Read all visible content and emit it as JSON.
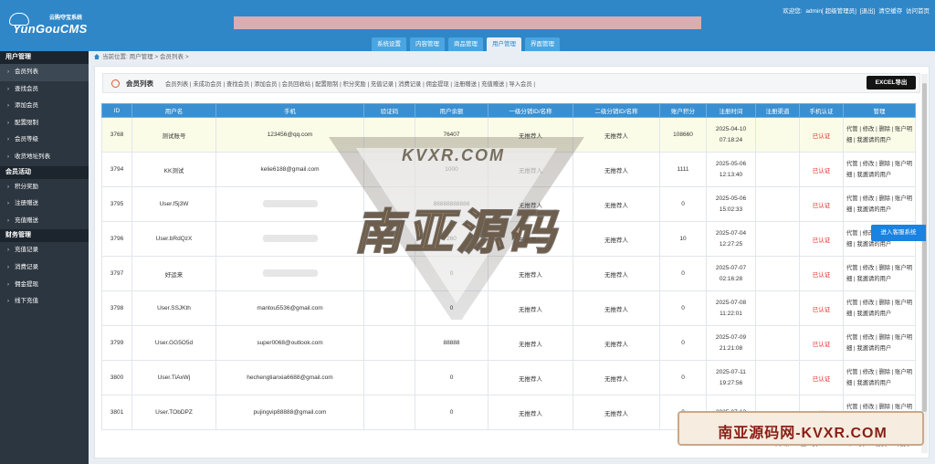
{
  "header": {
    "slogan": "云购夺宝系统",
    "brand": "YunGouCMS",
    "welcome": "欢迎您:",
    "user": "admin[ 超级管理员]",
    "logout": "[退出]",
    "clear_cache": "清空缓存",
    "visit_home": "访问首页",
    "tabs": [
      {
        "label": "系统设置",
        "active": false
      },
      {
        "label": "内容管理",
        "active": false
      },
      {
        "label": "商品管理",
        "active": false
      },
      {
        "label": "用户管理",
        "active": true
      },
      {
        "label": "界面管理",
        "active": false
      }
    ]
  },
  "sidebar": {
    "groups": [
      {
        "title": "用户管理",
        "items": [
          "会员列表",
          "查找会员",
          "添加会员",
          "配置限制",
          "会员等级",
          "收货地址列表"
        ]
      },
      {
        "title": "会员活动",
        "items": [
          "积分奖励",
          "注册赠送",
          "充值赠送"
        ]
      },
      {
        "title": "财务管理",
        "items": [
          "充值记录",
          "消费记录",
          "佣金提现",
          "线下充值"
        ]
      }
    ],
    "active_item": "会员列表"
  },
  "breadcrumb": "当前位置: 用户管理 > 会员列表 >",
  "subnav": {
    "title": "会员列表",
    "links": "会员列表 | 未成功会员 | 查找会员 | 添加会员 | 会员回收站 | 配置限制 | 积分奖励 | 充值记录 | 消费记录 | 佣金提现 | 注册赠送 | 充值赠送 | 导入会员 |",
    "excel_button": "EXCEL导出"
  },
  "table": {
    "columns": [
      "ID",
      "用户名",
      "手机",
      "验证码",
      "用户余额",
      "一级分销ID/名称",
      "二级分销ID/名称",
      "账户积分",
      "注册时间",
      "注册渠道",
      "手机认证",
      "管理"
    ],
    "rows": [
      {
        "id": "3768",
        "username": "测试账号",
        "phone": "123456@qq.com",
        "code": "",
        "balance": "76407",
        "level1": "无推荐人",
        "level2": "无推荐人",
        "points": "108660",
        "date": "2025-04-10",
        "time": "07:18:24",
        "channel": "",
        "auth": "已认证",
        "ops": "代管 | 修改 | 删除 | 账户明细 | 我邀请的用户",
        "highlight": true
      },
      {
        "id": "3794",
        "username": "KK测试",
        "phone": "kelie6188@gmail.com",
        "code": "",
        "balance": "1000",
        "level1": "无推荐人",
        "level2": "无推荐人",
        "points": "1111",
        "date": "2025-05-06",
        "time": "12:13:40",
        "channel": "",
        "auth": "已认证",
        "ops": "代管 | 修改 | 删除 | 账户明细 | 我邀请的用户",
        "highlight": false
      },
      {
        "id": "3795",
        "username": "User.f5j3W",
        "phone": "",
        "code": "",
        "balance": "88888888888",
        "level1": "无推荐人",
        "level2": "无推荐人",
        "points": "0",
        "date": "2025-05-06",
        "time": "15:02:33",
        "channel": "",
        "auth": "已认证",
        "ops": "代管 | 修改 | 删除 | 账户明细 | 我邀请的用户",
        "highlight": false
      },
      {
        "id": "3796",
        "username": "User.bRdQzX",
        "phone": "",
        "code": "",
        "balance": "260",
        "level1": "无推荐人",
        "level2": "无推荐人",
        "points": "10",
        "date": "2025-07-04",
        "time": "12:27:25",
        "channel": "",
        "auth": "已认证",
        "ops": "代管 | 修改 | 删除 | 账户明细 | 我邀请的用户",
        "highlight": false
      },
      {
        "id": "3797",
        "username": "好运来",
        "phone": "",
        "code": "",
        "balance": "0",
        "level1": "无推荐人",
        "level2": "无推荐人",
        "points": "0",
        "date": "2025-07-07",
        "time": "02:16:28",
        "channel": "",
        "auth": "已认证",
        "ops": "代管 | 修改 | 删除 | 账户明细 | 我邀请的用户",
        "highlight": false
      },
      {
        "id": "3798",
        "username": "User.SSJKth",
        "phone": "mantou5536@gmail.com",
        "code": "",
        "balance": "0",
        "level1": "无推荐人",
        "level2": "无推荐人",
        "points": "0",
        "date": "2025-07-08",
        "time": "11:22:01",
        "channel": "",
        "auth": "已认证",
        "ops": "代管 | 修改 | 删除 | 账户明细 | 我邀请的用户",
        "highlight": false
      },
      {
        "id": "3799",
        "username": "User.GG5O5d",
        "phone": "super0068@outlook.com",
        "code": "",
        "balance": "88888",
        "level1": "无推荐人",
        "level2": "无推荐人",
        "points": "0",
        "date": "2025-07-09",
        "time": "21:21:08",
        "channel": "",
        "auth": "已认证",
        "ops": "代管 | 修改 | 删除 | 账户明细 | 我邀请的用户",
        "highlight": false
      },
      {
        "id": "3800",
        "username": "User.TiAxWj",
        "phone": "hechengtianxia6688@gmail.com",
        "code": "",
        "balance": "0",
        "level1": "无推荐人",
        "level2": "无推荐人",
        "points": "0",
        "date": "2025-07-11",
        "time": "19:27:56",
        "channel": "",
        "auth": "已认证",
        "ops": "代管 | 修改 | 删除 | 账户明细 | 我邀请的用户",
        "highlight": false
      },
      {
        "id": "3801",
        "username": "User.TObDPZ",
        "phone": "pujingvip88888@gmail.com",
        "code": "",
        "balance": "0",
        "level1": "无推荐人",
        "level2": "无推荐人",
        "points": "0",
        "date": "2025-07-12",
        "time": "",
        "channel": "",
        "auth": "已认证",
        "ops": "代管 | 修改 | 删除 | 账户明细 | 我邀请的用户",
        "highlight": false
      }
    ]
  },
  "pager": {
    "total": "共9条",
    "prev": "上一页",
    "page": "1/1",
    "next": "下一页",
    "first": "首页",
    "last": "尾页"
  },
  "service_button": "进入客服系统",
  "watermark": {
    "small": "KVXR.COM",
    "big": "南亚源码",
    "corner": "南亚源码网-KVXR.COM"
  },
  "colors": {
    "header": "#2f87c8",
    "sidebar": "#2c3640",
    "table_head": "#3a8fd0",
    "auth_red": "#e0302a",
    "service_blue": "#1a82e0"
  }
}
